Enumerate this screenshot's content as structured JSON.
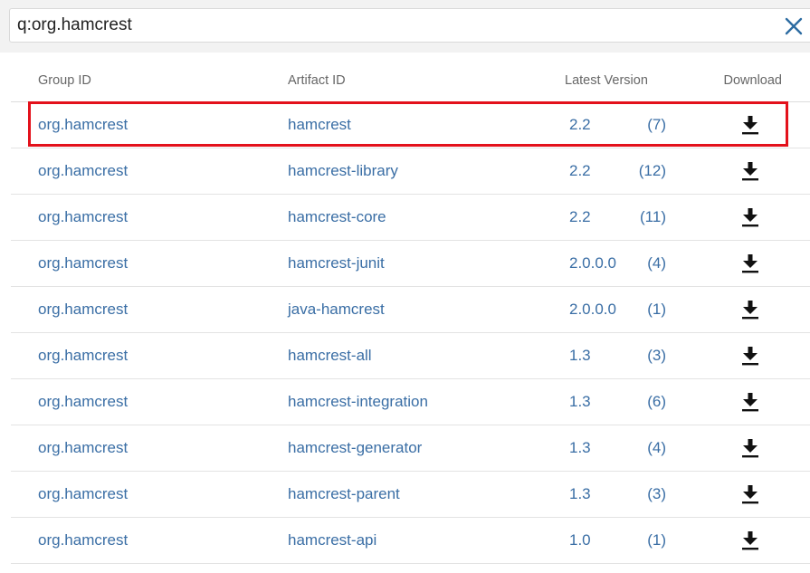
{
  "search": {
    "value": "q:org.hamcrest"
  },
  "icons": {
    "clear": "close-icon",
    "download": "download-icon"
  },
  "colors": {
    "link": "#3a6ea5",
    "header_text": "#666666",
    "highlight": "#e3111b"
  },
  "table": {
    "headers": {
      "group_id": "Group ID",
      "artifact_id": "Artifact ID",
      "latest_version": "Latest Version",
      "download": "Download"
    },
    "rows": [
      {
        "group": "org.hamcrest",
        "artifact": "hamcrest",
        "version": "2.2",
        "count": "(7)"
      },
      {
        "group": "org.hamcrest",
        "artifact": "hamcrest-library",
        "version": "2.2",
        "count": "(12)"
      },
      {
        "group": "org.hamcrest",
        "artifact": "hamcrest-core",
        "version": "2.2",
        "count": "(11)"
      },
      {
        "group": "org.hamcrest",
        "artifact": "hamcrest-junit",
        "version": "2.0.0.0",
        "count": "(4)"
      },
      {
        "group": "org.hamcrest",
        "artifact": "java-hamcrest",
        "version": "2.0.0.0",
        "count": "(1)"
      },
      {
        "group": "org.hamcrest",
        "artifact": "hamcrest-all",
        "version": "1.3",
        "count": "(3)"
      },
      {
        "group": "org.hamcrest",
        "artifact": "hamcrest-integration",
        "version": "1.3",
        "count": "(6)"
      },
      {
        "group": "org.hamcrest",
        "artifact": "hamcrest-generator",
        "version": "1.3",
        "count": "(4)"
      },
      {
        "group": "org.hamcrest",
        "artifact": "hamcrest-parent",
        "version": "1.3",
        "count": "(3)"
      },
      {
        "group": "org.hamcrest",
        "artifact": "hamcrest-api",
        "version": "1.0",
        "count": "(1)"
      }
    ]
  }
}
